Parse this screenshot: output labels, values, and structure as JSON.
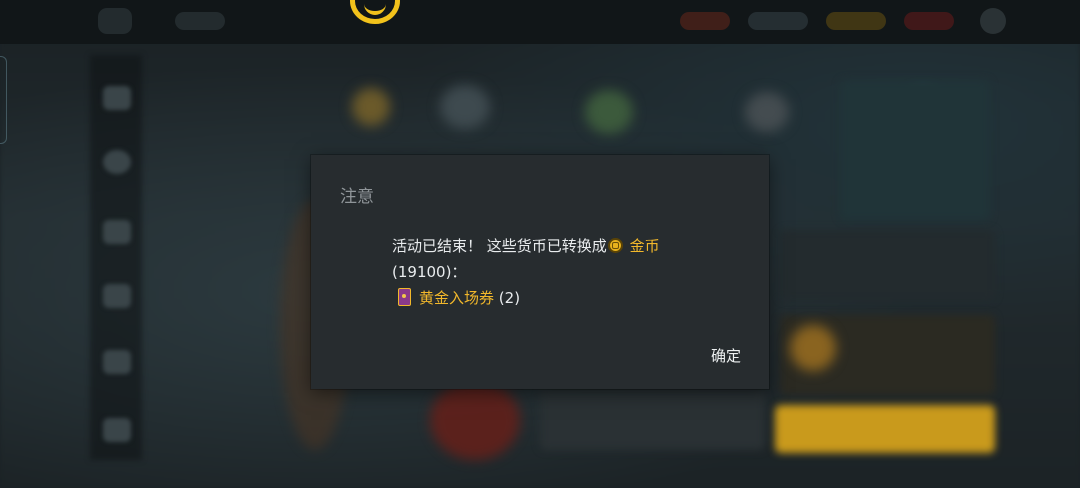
{
  "dialog": {
    "title": "注意",
    "message_line1": "活动已结束！ 这些货币已转换成",
    "currency_name": "金币",
    "currency_amount": "(19100)：",
    "reward_name": "黄金入场券",
    "reward_count": "(2)",
    "confirm_label": "确定"
  },
  "icons": {
    "currency": "gold-coin-icon",
    "reward": "golden-ticket-icon",
    "logo": "game-logo-icon"
  },
  "colors": {
    "dialog_bg": "#272c2f",
    "title": "#8f9599",
    "body_text": "#e9ecee",
    "highlight": "#f2b82b",
    "logo": "#f2c21b"
  }
}
